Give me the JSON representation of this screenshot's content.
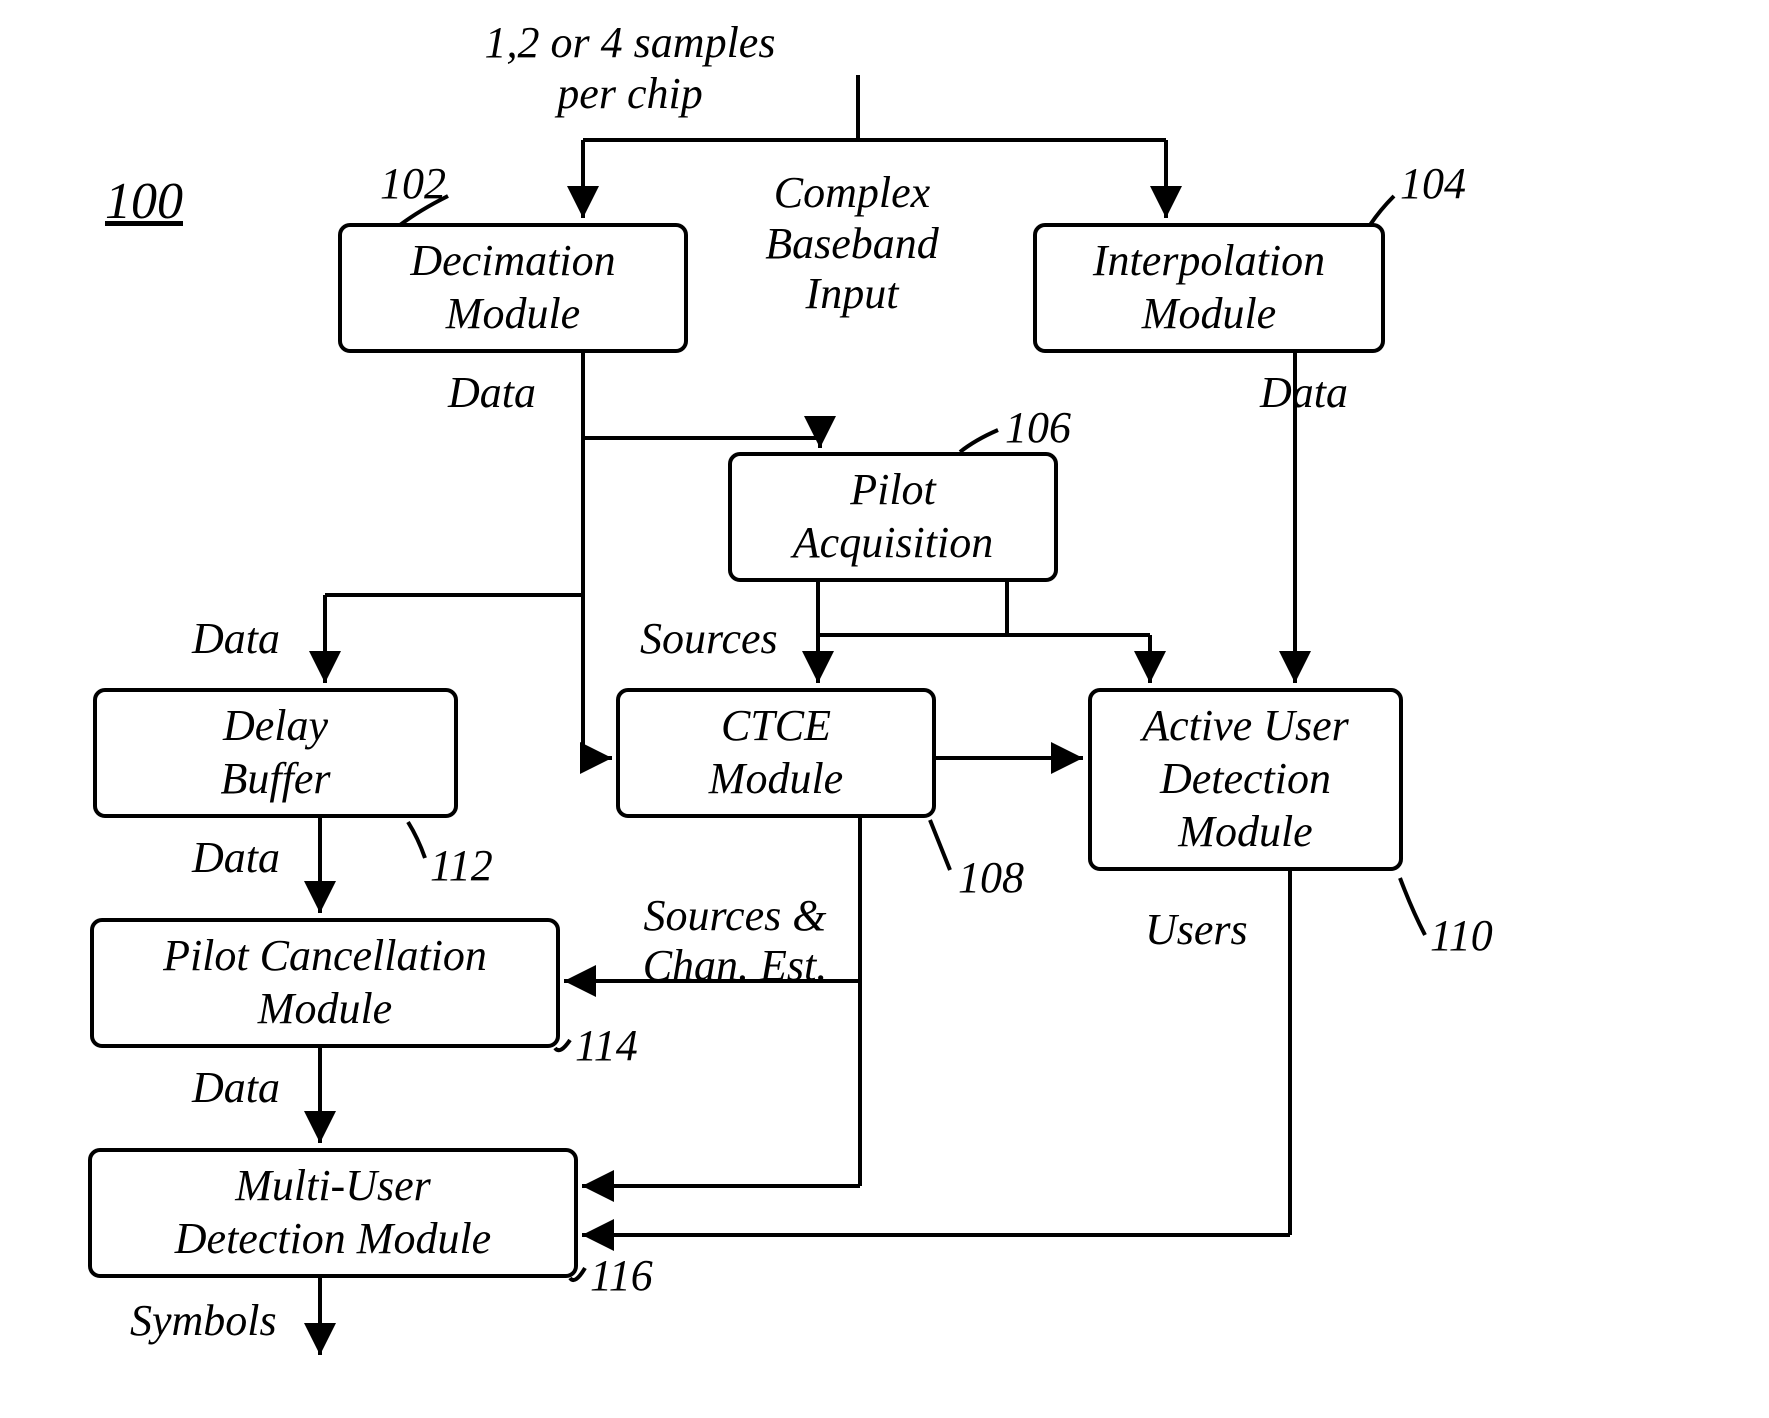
{
  "figure_number": "100",
  "input_label_top": "1,2 or 4 samples\nper chip",
  "input_label_mid": "Complex\nBaseband\nInput",
  "boxes": {
    "decimation": {
      "line1": "Decimation",
      "line2": "Module",
      "ref": "102"
    },
    "interpolation": {
      "line1": "Interpolation",
      "line2": "Module",
      "ref": "104"
    },
    "pilot_acq": {
      "line1": "Pilot",
      "line2": "Acquisition",
      "ref": "106"
    },
    "ctce": {
      "line1": "CTCE",
      "line2": "Module",
      "ref": "108"
    },
    "active_user": {
      "line1": "Active User",
      "line2": "Detection",
      "line3": "Module",
      "ref": "110"
    },
    "delay_buffer": {
      "line1": "Delay",
      "line2": "Buffer",
      "ref": "112"
    },
    "pilot_cancel": {
      "line1": "Pilot Cancellation",
      "line2": "Module",
      "ref": "114"
    },
    "multi_user": {
      "line1": "Multi-User",
      "line2": "Detection Module",
      "ref": "116"
    }
  },
  "edge_labels": {
    "decimation_out": "Data",
    "interpolation_out": "Data",
    "pilot_acq_out": "Sources",
    "ctce_out": "Sources &\nChan. Est.",
    "active_user_out": "Users",
    "delay_in": "Data",
    "delay_out": "Data",
    "pilot_cancel_out": "Data",
    "multi_user_out": "Symbols"
  }
}
